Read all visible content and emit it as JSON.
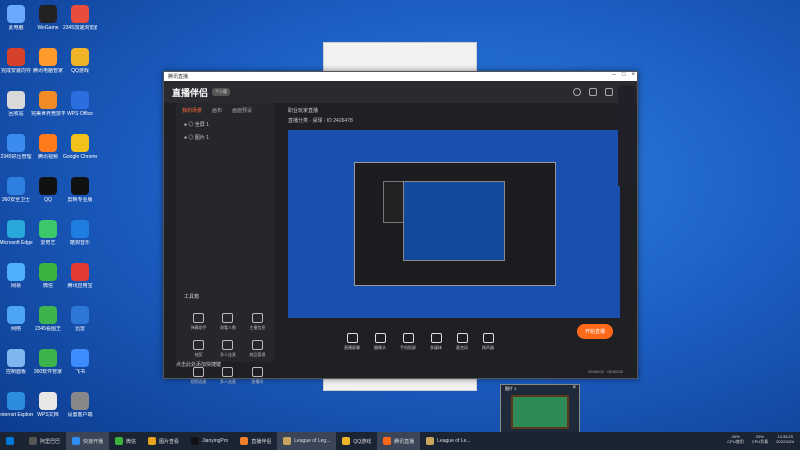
{
  "desktop": {
    "col1": [
      {
        "label": "此电脑",
        "color": "#6aa9ff"
      },
      {
        "label": "完成安装向导",
        "color": "#d7402b"
      },
      {
        "label": "回收站",
        "color": "#d9d9d9"
      },
      {
        "label": "2345好压管理",
        "color": "#3c8cf0"
      },
      {
        "label": "360安全卫士",
        "color": "#2e7fe0"
      },
      {
        "label": "Microsoft Edge",
        "color": "#29a8d9"
      },
      {
        "label": "网易",
        "color": "#4fb0ff"
      },
      {
        "label": "网络",
        "color": "#4da3f4"
      },
      {
        "label": "控制面板",
        "color": "#7fb6f0"
      },
      {
        "label": "Internet Explorer",
        "color": "#2a8de0"
      }
    ],
    "col2": [
      {
        "label": "WeGame",
        "color": "#222"
      },
      {
        "label": "腾讯电脑管家",
        "color": "#ff9a2b"
      },
      {
        "label": "完美世界竞技平台",
        "color": "#f08a24"
      },
      {
        "label": "腾讯视频",
        "color": "#ff7a1a"
      },
      {
        "label": "QQ",
        "color": "#111"
      },
      {
        "label": "爱奇艺",
        "color": "#3cc76b"
      },
      {
        "label": "微信",
        "color": "#3cb33c"
      },
      {
        "label": "2345看图王",
        "color": "#3cb34d"
      },
      {
        "label": "360软件管家",
        "color": "#3cb34d"
      },
      {
        "label": "WPS文档",
        "color": "#e8e8e8"
      }
    ],
    "col3": [
      {
        "label": "2345加速浏览器",
        "color": "#e84c3d"
      },
      {
        "label": "QQ游戏",
        "color": "#f0b429"
      },
      {
        "label": "WPS Office",
        "color": "#2b6ee0"
      },
      {
        "label": "Google Chrome",
        "color": "#f2c21b"
      },
      {
        "label": "剪映专业版",
        "color": "#111"
      },
      {
        "label": "酷狗音乐",
        "color": "#1e7fe0"
      },
      {
        "label": "腾讯应用宝",
        "color": "#e53935"
      },
      {
        "label": "迅雷",
        "color": "#2d77d6"
      },
      {
        "label": "飞书",
        "color": "#3f8cff"
      },
      {
        "label": "设置客户端",
        "color": "#888"
      }
    ]
  },
  "app": {
    "window_title": "腾讯直播",
    "brand": "直播伴侣",
    "version_badge": "个人版",
    "tabs": [
      "我的场景",
      "画布",
      "画面预设"
    ],
    "scenes": [
      "● ◎  全屏 1",
      "● ◎  图片 1"
    ],
    "tools_title": "工具箱",
    "tools": [
      "弹幕助手",
      "观看人数",
      "主播信息",
      "抽奖",
      "多人连麦",
      "商品管理",
      "视频连麦",
      "多人连麦",
      "直播间"
    ],
    "notice": "点击此处添加快捷键",
    "room_title": "职业玩家直播",
    "room_info": "直播分类 · 桌球 · ID 2426478",
    "controls": [
      "直播屏幕",
      "摄像头",
      "手机投屏",
      "多媒体",
      "麦克风",
      "扬声器"
    ],
    "live_button": "开始直播",
    "status": "00:00:02  ·  00:00:02"
  },
  "thumb": {
    "title": "图片 1",
    "close": "×"
  },
  "taskbar": {
    "items": [
      {
        "label": "",
        "color": "#0078d7",
        "active": false
      },
      {
        "label": "阿里巴巴",
        "color": "#555",
        "active": false
      },
      {
        "label": "快速开播",
        "color": "#2d8cf0",
        "active": true
      },
      {
        "label": "微信",
        "color": "#3cb33c",
        "active": false
      },
      {
        "label": "图片查看",
        "color": "#e8a31d",
        "active": false
      },
      {
        "label": "JianyingPro",
        "color": "#111",
        "active": false
      },
      {
        "label": "直播伴侣",
        "color": "#f07f2b",
        "active": false
      },
      {
        "label": "League of Leg...",
        "color": "#c8a45e",
        "active": true
      },
      {
        "label": "QQ游戏",
        "color": "#f0b429",
        "active": false
      },
      {
        "label": "腾讯直播",
        "color": "#ff6a1a",
        "active": true
      },
      {
        "label": "League of Le...",
        "color": "#c8a45e",
        "active": false
      }
    ],
    "cpu": "26%",
    "cpu_label": "CPU使用",
    "mem": "25%",
    "mem_label": "CPU负载",
    "time": "13:33:29",
    "date": "2022/3/24"
  }
}
